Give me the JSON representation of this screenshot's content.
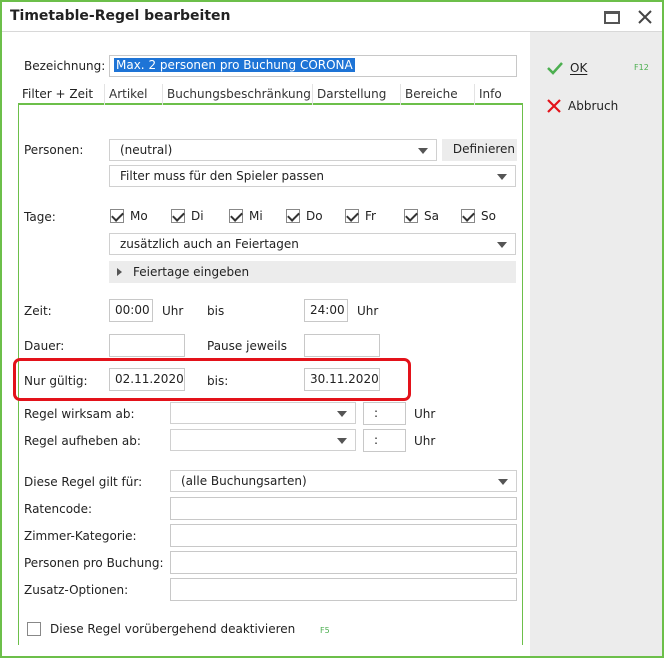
{
  "window": {
    "title": "Timetable-Regel bearbeiten"
  },
  "actions": {
    "ok_label": "OK",
    "ok_key": "F12",
    "cancel_label": "Abbruch",
    "ok_color": "#4caf50",
    "cancel_color": "#e3121a"
  },
  "bezeichnung": {
    "label": "Bezeichnung:",
    "value": "Max. 2 personen pro Buchung CORONA"
  },
  "tabs": [
    {
      "label": "Filter + Zeit",
      "active": true
    },
    {
      "label": "Artikel"
    },
    {
      "label": "Buchungsbeschränkung"
    },
    {
      "label": "Darstellung"
    },
    {
      "label": "Bereiche"
    },
    {
      "label": "Info"
    }
  ],
  "personen": {
    "label": "Personen:",
    "value": "(neutral)",
    "define_label": "Definieren",
    "filter_value": "Filter muss für den Spieler passen"
  },
  "tage": {
    "label": "Tage:",
    "days": [
      {
        "label": "Mo",
        "checked": true
      },
      {
        "label": "Di",
        "checked": true
      },
      {
        "label": "Mi",
        "checked": true
      },
      {
        "label": "Do",
        "checked": true
      },
      {
        "label": "Fr",
        "checked": true
      },
      {
        "label": "Sa",
        "checked": true
      },
      {
        "label": "So",
        "checked": true
      }
    ],
    "holiday_option": "zusätzlich auch an Feiertagen",
    "holiday_expander": "Feiertage eingeben"
  },
  "zeit": {
    "label": "Zeit:",
    "from": "00:00",
    "unit1": "Uhr",
    "bis": "bis",
    "to": "24:00",
    "unit2": "Uhr"
  },
  "dauer": {
    "label": "Dauer:",
    "value": "",
    "pause_label": "Pause jeweils",
    "pause_value": ""
  },
  "gueltig": {
    "label": "Nur gültig:",
    "from": "02.11.2020",
    "bis": "bis:",
    "to": "30.11.2020"
  },
  "wirksam": {
    "label": "Regel wirksam ab:",
    "date": "",
    "time": ":",
    "unit": "Uhr"
  },
  "aufheben": {
    "label": "Regel aufheben ab:",
    "date": "",
    "time": ":",
    "unit": "Uhr"
  },
  "gilt_fuer": {
    "label": "Diese Regel gilt für:",
    "value": "(alle Buchungsarten)"
  },
  "ratencode": {
    "label": "Ratencode:",
    "value": ""
  },
  "zimmer": {
    "label": "Zimmer-Kategorie:",
    "value": ""
  },
  "personen_buchung": {
    "label": "Personen pro Buchung:",
    "value": ""
  },
  "zusatz": {
    "label": "Zusatz-Optionen:",
    "value": ""
  },
  "deaktivieren": {
    "label": "Diese Regel vorübergehend deaktivieren",
    "key": "F5",
    "checked": false
  }
}
